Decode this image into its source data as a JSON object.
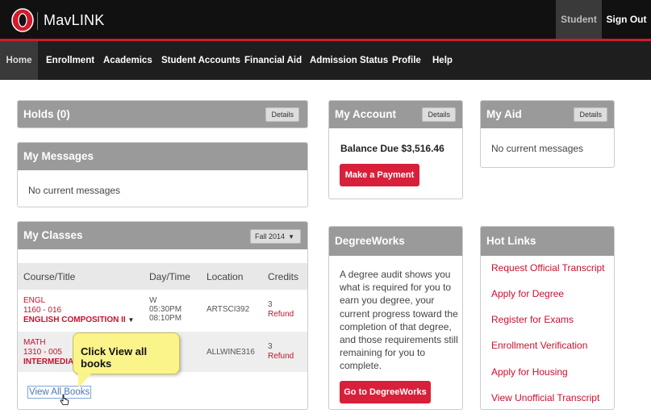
{
  "app": {
    "brand": "MavLINK",
    "logo_icon": "uno-o-logo-icon",
    "student_label": "Student",
    "signout_label": "Sign Out"
  },
  "colors": {
    "accent_red": "#d01c2c",
    "header_gray": "#9a9a9a",
    "callout_yellow": "#fbf48a"
  },
  "nav": {
    "items": [
      "Home",
      "Enrollment",
      "Academics",
      "Student Accounts",
      "Financial Aid",
      "Admission Status",
      "Profile",
      "Help"
    ]
  },
  "holds": {
    "title": "Holds (0)",
    "details_label": "Details"
  },
  "messages": {
    "title": "My Messages",
    "empty": "No current messages"
  },
  "classes": {
    "title": "My Classes",
    "term": "Fall 2014",
    "headers": [
      "Course/Title",
      "Day/Time",
      "Location",
      "Credits"
    ],
    "rows": [
      {
        "subject": "ENGL",
        "number": "1160 - 016",
        "title": "ENGLISH COMPOSITION II",
        "day": "W",
        "time_start": "05:30PM",
        "time_end": "08:10PM",
        "location": "ARTSCI392",
        "credits": "3",
        "refund": "Refund"
      },
      {
        "subject": "MATH",
        "number": "1310 - 005",
        "title": "INTERMEDIATE",
        "location": "ALLWINE316",
        "credits": "3",
        "refund": "Refund"
      }
    ],
    "view_all": "View All Books"
  },
  "callout": {
    "text": "Click View all books"
  },
  "account": {
    "title": "My Account",
    "details_label": "Details",
    "balance": "Balance Due $3,516.46",
    "pay_button": "Make a Payment"
  },
  "aid": {
    "title": "My Aid",
    "details_label": "Details",
    "empty": "No current messages"
  },
  "degreeworks": {
    "title": "DegreeWorks",
    "lines": [
      "A degree audit shows you",
      "what is required for you to",
      "earn you degree, your",
      "current progress toward the",
      "completion of that degree,",
      "and those requirements still",
      "remaining for you to",
      "complete."
    ],
    "button": "Go to DegreeWorks"
  },
  "hotlinks": {
    "title": "Hot Links",
    "items": [
      "Request Official Transcript",
      "Apply for Degree",
      "Register for Exams",
      "Enrollment Verification",
      "Apply for Housing",
      "View Unofficial Transcript"
    ]
  }
}
